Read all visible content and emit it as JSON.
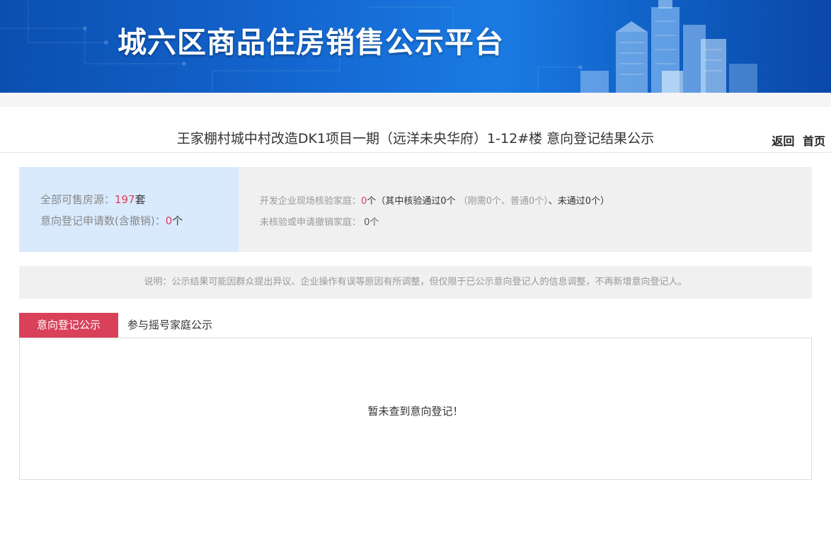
{
  "banner": {
    "title": "城六区商品住房销售公示平台"
  },
  "project": {
    "title": "王家棚村城中村改造DK1项目一期（远洋未央华府）1-12#楼 意向登记结果公示"
  },
  "nav": {
    "back_label": "返回",
    "home_label": "首页"
  },
  "stats": {
    "available_label": "全部可售房源：",
    "available_value": "197",
    "available_unit": "套",
    "applications_label": "意向登记申请数(含撤销)：",
    "applications_value": "0",
    "applications_unit": "个",
    "verified_label": "开发企业现场核验家庭：",
    "verified_value": "0",
    "verified_unit": "个",
    "verified_detail_open": "（其中核验通过0个",
    "verified_detail_mid": "（刚需0个、普通0个）",
    "verified_detail_close": "、未通过0个）",
    "unverified_label": "未核验或申请撤销家庭：",
    "unverified_value": "0个"
  },
  "notice": {
    "text": "说明：公示结果可能因群众提出异议、企业操作有误等原因有所调整，但仅限于已公示意向登记人的信息调整，不再新增意向登记人。"
  },
  "tabs": [
    {
      "label": "意向登记公示",
      "active": true
    },
    {
      "label": "参与摇号家庭公示",
      "active": false
    }
  ],
  "content": {
    "empty_message": "暂未查到意向登记！"
  },
  "colors": {
    "accent": "#d9405a",
    "banner_blue": "#1466cf",
    "stats_left_bg": "#d9eafd",
    "panel_bg": "#f0f0f0"
  }
}
